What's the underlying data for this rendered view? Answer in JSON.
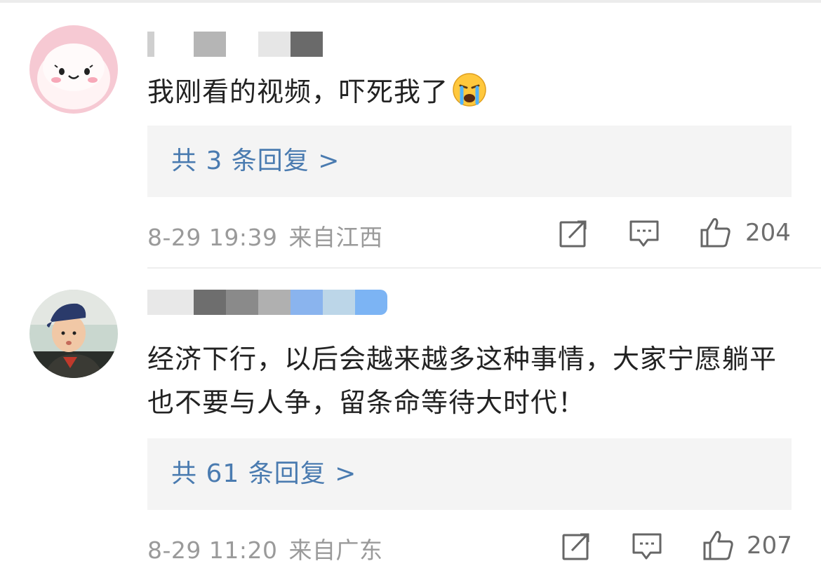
{
  "comments": [
    {
      "text": "我刚看的视频，吓死我了",
      "emoji": "crying-face",
      "replies_label": "共 3 条回复 >",
      "date": "8-29 19:39",
      "location": "来自江西",
      "likes": "204"
    },
    {
      "text": "经济下行，以后会越来越多这种事情，大家宁愿躺平也不要与人争，留条命等待大时代！",
      "replies_label": "共 61 条回复 >",
      "date": "8-29 11:20",
      "location": "来自广东",
      "likes": "207"
    }
  ],
  "colors": {
    "link": "#4a7bb0",
    "meta": "#9a9a9a",
    "reply_bg": "#f4f4f4"
  },
  "icons": [
    "share-icon",
    "comment-icon",
    "like-icon"
  ]
}
